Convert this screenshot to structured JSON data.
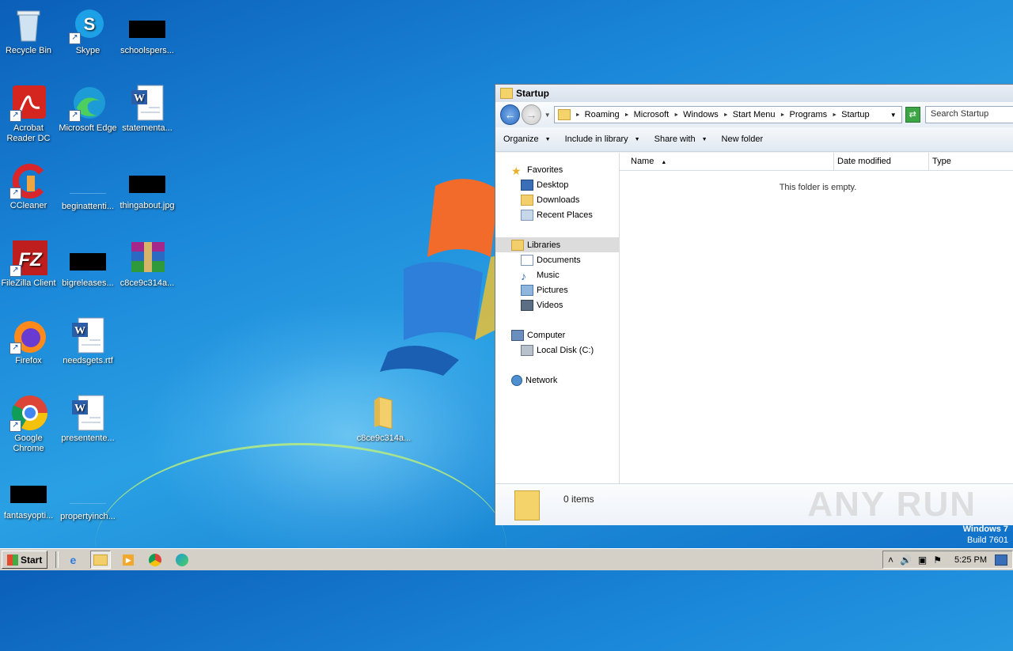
{
  "desktop": {
    "icons": [
      {
        "label": "Recycle Bin",
        "icon": "recycle-bin-icon"
      },
      {
        "label": "Skype",
        "icon": "skype-icon"
      },
      {
        "label": "schoolspers...",
        "icon": "redacted-icon"
      },
      {
        "label": "Acrobat Reader DC",
        "icon": "acrobat-icon"
      },
      {
        "label": "Microsoft Edge",
        "icon": "edge-icon"
      },
      {
        "label": "statementa...",
        "icon": "word-doc-icon"
      },
      {
        "label": "CCleaner",
        "icon": "ccleaner-icon"
      },
      {
        "label": "beginattenti...",
        "icon": "blank-file-icon"
      },
      {
        "label": "thingabout.jpg",
        "icon": "redacted-icon"
      },
      {
        "label": "FileZilla Client",
        "icon": "filezilla-icon"
      },
      {
        "label": "bigreleases...",
        "icon": "redacted-icon"
      },
      {
        "label": "c8ce9c314a...",
        "icon": "winrar-icon"
      },
      {
        "label": "Firefox",
        "icon": "firefox-icon"
      },
      {
        "label": "needsgets.rtf",
        "icon": "word-doc-icon"
      },
      {
        "label": "Google Chrome",
        "icon": "chrome-icon"
      },
      {
        "label": "presentente...",
        "icon": "word-doc-icon"
      },
      {
        "label": "fantasyopti...",
        "icon": "redacted-icon"
      },
      {
        "label": "propertyinch...",
        "icon": "blank-file-icon"
      },
      {
        "label": "c8ce9c314a...",
        "icon": "folder-icon"
      }
    ],
    "branding": {
      "line1": "Windows 7",
      "line2": "Build 7601"
    }
  },
  "explorer": {
    "title": "Startup",
    "breadcrumbs": [
      "Roaming",
      "Microsoft",
      "Windows",
      "Start Menu",
      "Programs",
      "Startup"
    ],
    "search_placeholder": "Search Startup",
    "commands": [
      "Organize",
      "Include in library",
      "Share with",
      "New folder"
    ],
    "nav": {
      "favorites": "Favorites",
      "favorites_items": [
        "Desktop",
        "Downloads",
        "Recent Places"
      ],
      "libraries": "Libraries",
      "libraries_items": [
        "Documents",
        "Music",
        "Pictures",
        "Videos"
      ],
      "computer": "Computer",
      "computer_items": [
        "Local Disk (C:)"
      ],
      "network": "Network"
    },
    "columns": [
      "Name",
      "Date modified",
      "Type"
    ],
    "empty_message": "This folder is empty.",
    "item_count": "0 items"
  },
  "watermark": "ANY RUN",
  "taskbar": {
    "start_label": "Start",
    "clock": "5:25 PM"
  }
}
